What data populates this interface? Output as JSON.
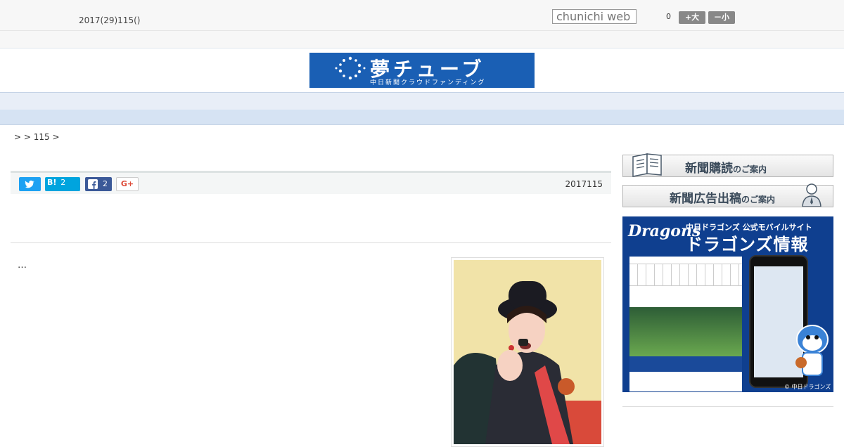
{
  "header": {
    "date": "2017(29)115()",
    "search_placeholder": "chunichi web",
    "font_size": {
      "count": "0",
      "larger_label": "+大",
      "smaller_label": "－小"
    }
  },
  "banner": {
    "title": "夢チューブ",
    "subtitle": "中日新聞クラウドファンディング",
    "color": "#1a5fb4"
  },
  "nav": {
    "items": [
      "",
      "",
      "",
      "",
      "",
      "",
      "",
      "",
      ""
    ]
  },
  "breadcrumb": ">  > 115 >",
  "share": {
    "hatena_label": "B!",
    "hatena_count": "2",
    "facebook_count": "2",
    "google_label": "G+"
  },
  "article": {
    "date": "2017115",
    "lead": "…"
  },
  "sidebar": {
    "subscribe": {
      "label": "新聞購読",
      "suffix": "のご案内"
    },
    "advertise": {
      "label": "新聞広告出稿",
      "suffix": "のご案内"
    },
    "dragons": {
      "brand": "Dragons",
      "line1": "中日ドラゴンズ 公式モバイルサイト",
      "line2": "ドラゴンズ情報",
      "footer": "© 中日ドラゴンズ"
    }
  },
  "colors": {
    "accent": "#1a5fb4",
    "nav_bg": "#e8eef7",
    "twitter": "#1da1f2",
    "hatena": "#00a4de",
    "facebook": "#3b5998"
  }
}
